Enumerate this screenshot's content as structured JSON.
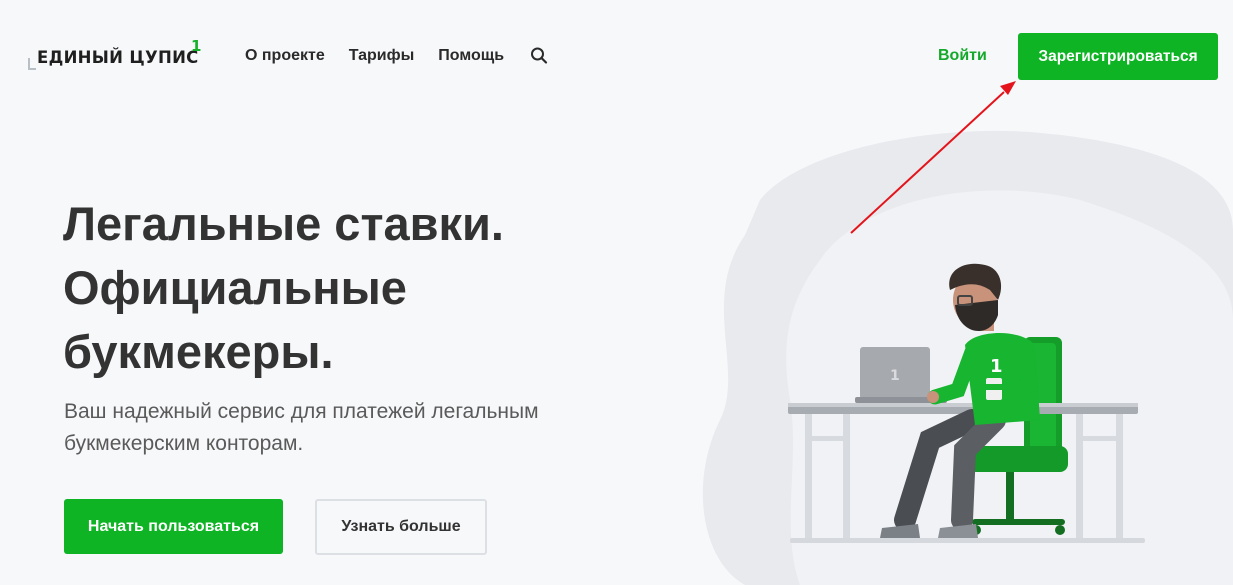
{
  "header": {
    "logo_text": "ЕДИНЫЙ ЦУПИС",
    "logo_superscript": "1",
    "nav": [
      {
        "label": "О проекте"
      },
      {
        "label": "Тарифы"
      },
      {
        "label": "Помощь"
      }
    ],
    "search_icon": "search-icon",
    "login_label": "Войти",
    "register_label": "Зарегистрироваться"
  },
  "hero": {
    "title_lines": [
      "Легальные ставки.",
      "Официальные",
      "букмекеры."
    ],
    "subtitle_lines": [
      "Ваш надежный сервис для платежей легальным",
      "букмекерским конторам."
    ],
    "primary_button": "Начать пользоваться",
    "secondary_button": "Узнать больше"
  },
  "illustration": {
    "shirt_number": "1",
    "laptop_logo": "1"
  },
  "annotation": {
    "type": "red-arrow",
    "points_to": "register-button"
  },
  "colors": {
    "brand_green": "#0eb424",
    "link_green": "#14a92a",
    "background": "#f7f8fa",
    "annotation_red": "#e3141b"
  }
}
